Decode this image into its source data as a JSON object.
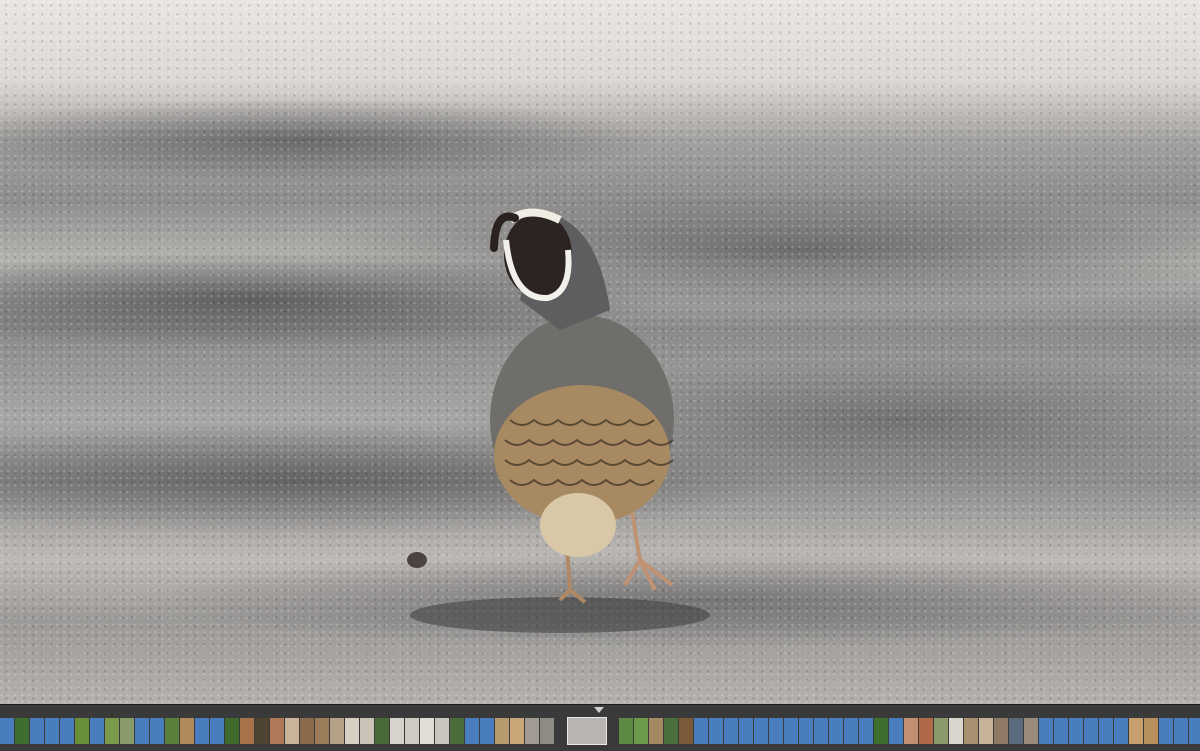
{
  "viewer": {
    "photo_subject": "",
    "accent": "#2a2a2a"
  },
  "filmstrip": {
    "position_marker_icon": "triangle-down-icon",
    "thumbnails": [
      {
        "color": "#4a7dbd"
      },
      {
        "color": "#3f6f2e"
      },
      {
        "color": "#4a7dbd"
      },
      {
        "color": "#4a7dbd"
      },
      {
        "color": "#4a7dbd"
      },
      {
        "color": "#6a8f3a"
      },
      {
        "color": "#4a7dbd"
      },
      {
        "color": "#7a9a4a"
      },
      {
        "color": "#8a9b6a"
      },
      {
        "color": "#4a7dbd"
      },
      {
        "color": "#4a7dbd"
      },
      {
        "color": "#5b7f3d"
      },
      {
        "color": "#b08a5a"
      },
      {
        "color": "#4a7dbd"
      },
      {
        "color": "#4a7dbd"
      },
      {
        "color": "#3e6b2c"
      },
      {
        "color": "#a6734a"
      },
      {
        "color": "#4f4332"
      },
      {
        "color": "#b07a58"
      },
      {
        "color": "#c9b49a"
      },
      {
        "color": "#8a6a4a"
      },
      {
        "color": "#9c7d5a"
      },
      {
        "color": "#b5a088"
      },
      {
        "color": "#d8cfc2"
      },
      {
        "color": "#c9c3b8"
      },
      {
        "color": "#4a6a3a"
      },
      {
        "color": "#d6d3cc"
      },
      {
        "color": "#cfcac2"
      },
      {
        "color": "#e0ddd7"
      },
      {
        "color": "#c9c6c0"
      },
      {
        "color": "#4b6d3a"
      },
      {
        "color": "#4a7dbd"
      },
      {
        "color": "#4a7dbd"
      },
      {
        "color": "#b79a6e"
      },
      {
        "color": "#c9a779"
      },
      {
        "color": "#a09a92"
      },
      {
        "color": "#8f8a84"
      },
      {
        "gap": true
      },
      {
        "selected": true,
        "color": "#b9b6b2"
      },
      {
        "gap": true
      },
      {
        "color": "#5e8a44"
      },
      {
        "color": "#6b9a4a"
      },
      {
        "color": "#a38a62"
      },
      {
        "color": "#4a6f3a"
      },
      {
        "color": "#7b5a3a"
      },
      {
        "color": "#4a7dbd"
      },
      {
        "color": "#4a7dbd"
      },
      {
        "color": "#4a7dbd"
      },
      {
        "color": "#4a7dbd"
      },
      {
        "color": "#4a7dbd"
      },
      {
        "color": "#4a7dbd"
      },
      {
        "color": "#4a7dbd"
      },
      {
        "color": "#4a7dbd"
      },
      {
        "color": "#4a7dbd"
      },
      {
        "color": "#4a7dbd"
      },
      {
        "color": "#4a7dbd"
      },
      {
        "color": "#4a7dbd"
      },
      {
        "color": "#3f6f2e"
      },
      {
        "color": "#4a7dbd"
      },
      {
        "color": "#c09070"
      },
      {
        "color": "#b06a4a"
      },
      {
        "color": "#8a9a6a"
      },
      {
        "color": "#d9d4cc"
      },
      {
        "color": "#a89070"
      },
      {
        "color": "#c7b39a"
      },
      {
        "color": "#8e7a66"
      },
      {
        "color": "#5a6a7a"
      },
      {
        "color": "#9a8a7a"
      },
      {
        "color": "#4a7dbd"
      },
      {
        "color": "#4a7dbd"
      },
      {
        "color": "#4a7dbd"
      },
      {
        "color": "#4a7dbd"
      },
      {
        "color": "#4a7dbd"
      },
      {
        "color": "#4a7dbd"
      },
      {
        "color": "#c8a070"
      },
      {
        "color": "#b89060"
      },
      {
        "color": "#4a7dbd"
      },
      {
        "color": "#4a7dbd"
      },
      {
        "color": "#4a7dbd"
      },
      {
        "color": "#4a7dbd"
      }
    ]
  }
}
